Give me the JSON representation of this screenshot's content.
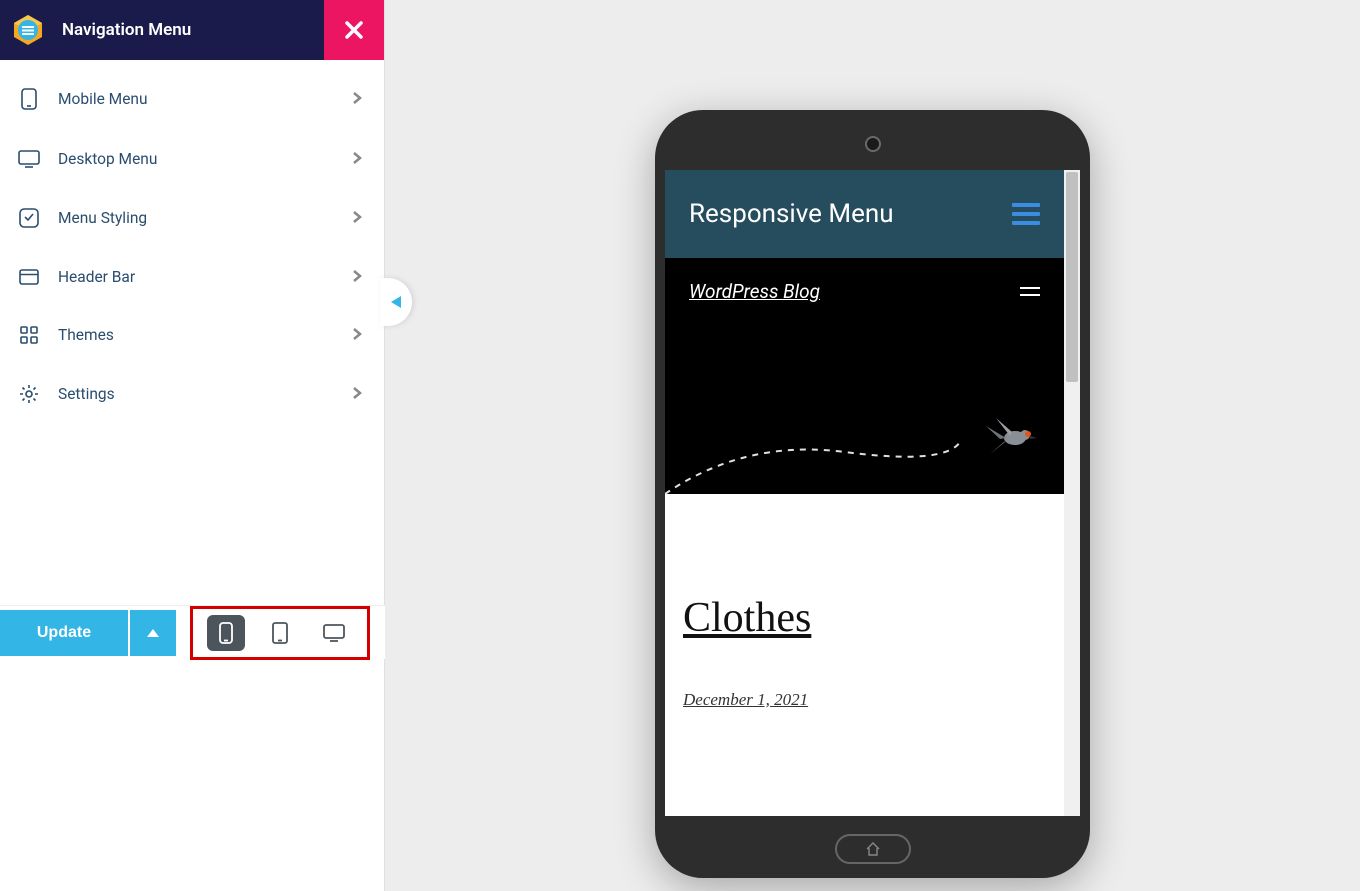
{
  "sidebar": {
    "title": "Navigation Menu",
    "items": [
      {
        "label": "Mobile Menu",
        "icon": "mobile"
      },
      {
        "label": "Desktop Menu",
        "icon": "desktop"
      },
      {
        "label": "Menu Styling",
        "icon": "styling"
      },
      {
        "label": "Header Bar",
        "icon": "header"
      },
      {
        "label": "Themes",
        "icon": "grid"
      },
      {
        "label": "Settings",
        "icon": "gear"
      }
    ],
    "update_label": "Update"
  },
  "preview": {
    "rm_title": "Responsive Menu",
    "site_title": "WordPress Blog",
    "post_title": "Clothes",
    "post_date": "December 1, 2021"
  },
  "colors": {
    "brand": "#eb1561",
    "header": "#1a1b4b",
    "accent": "#33b5e5",
    "rm_header": "#264d5e",
    "hamburger": "#3a8de0",
    "highlight_box": "#d40000"
  }
}
